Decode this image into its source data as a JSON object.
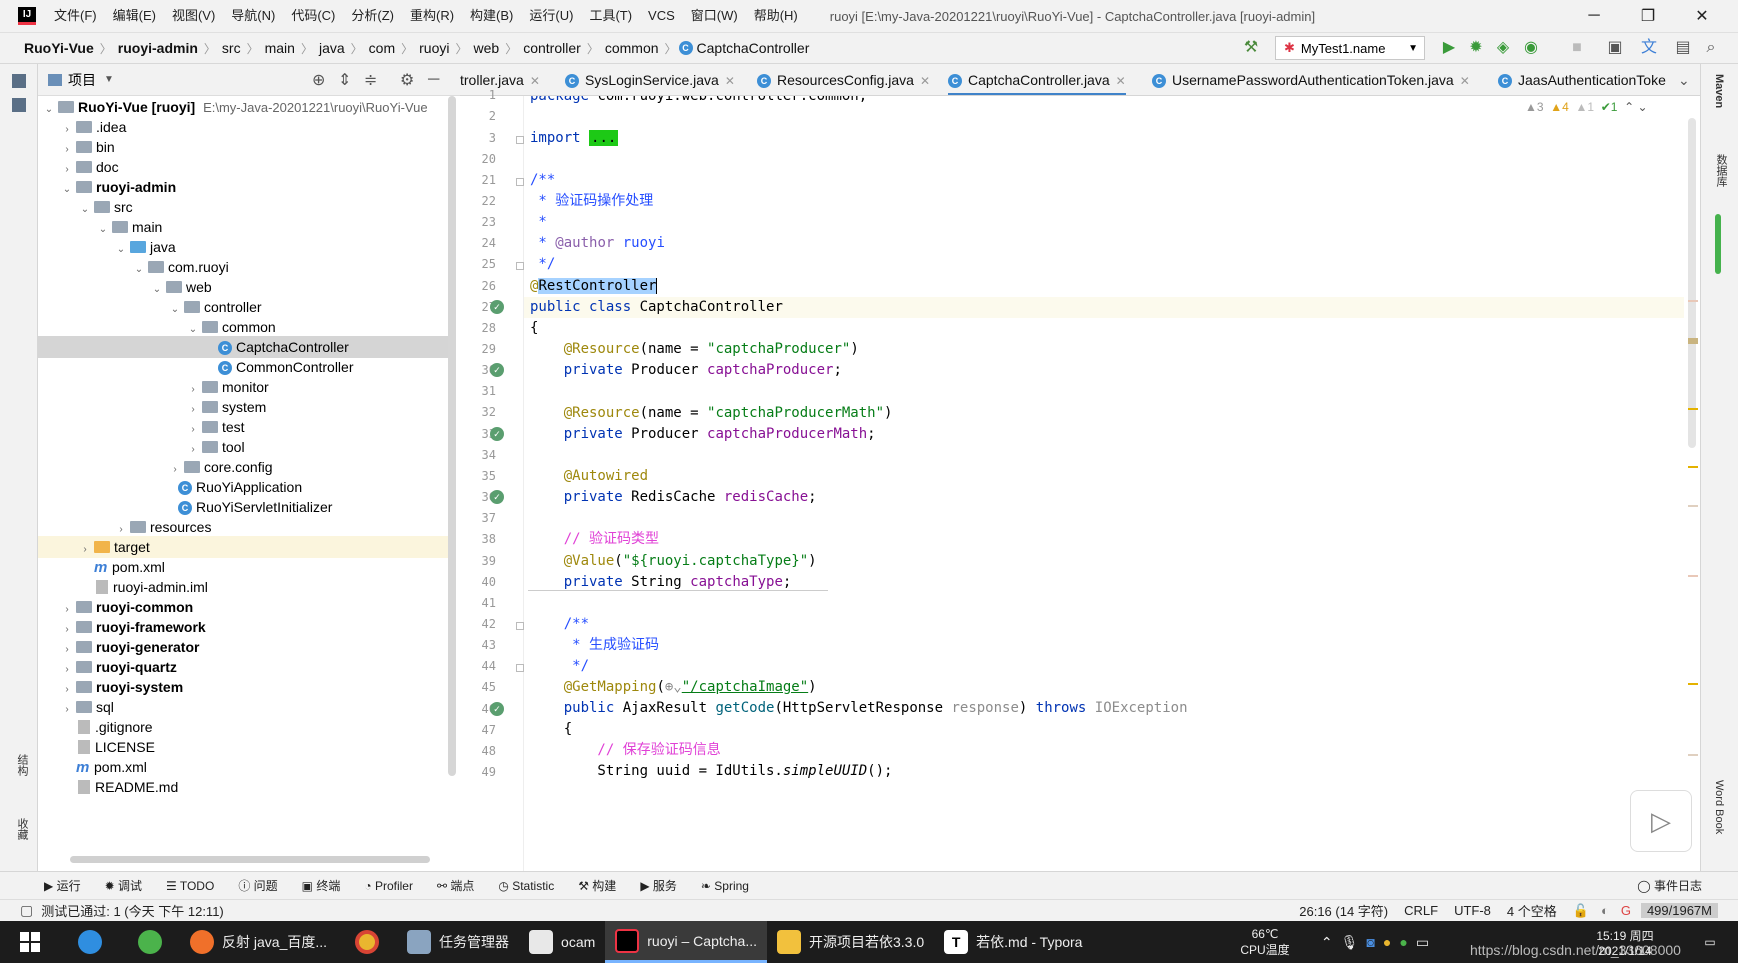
{
  "menubar": {
    "items": [
      "文件(F)",
      "编辑(E)",
      "视图(V)",
      "导航(N)",
      "代码(C)",
      "分析(Z)",
      "重构(R)",
      "构建(B)",
      "运行(U)",
      "工具(T)",
      "VCS",
      "窗口(W)",
      "帮助(H)"
    ],
    "title": "ruoyi [E:\\my-Java-20201221\\ruoyi\\RuoYi-Vue] - CaptchaController.java [ruoyi-admin]"
  },
  "breadcrumb": [
    "RuoYi-Vue",
    "ruoyi-admin",
    "src",
    "main",
    "java",
    "com",
    "ruoyi",
    "web",
    "controller",
    "common",
    "CaptchaController"
  ],
  "run_config": "MyTest1.name",
  "project_panel": {
    "title": "项目",
    "root_name": "RuoYi-Vue [ruoyi]",
    "root_path": "E:\\my-Java-20201221\\ruoyi\\RuoYi-Vue",
    "items": [
      ".idea",
      "bin",
      "doc",
      "ruoyi-admin",
      "src",
      "main",
      "java",
      "com.ruoyi",
      "web",
      "controller",
      "common",
      "CaptchaController",
      "CommonController",
      "monitor",
      "system",
      "test",
      "tool",
      "core.config",
      "RuoYiApplication",
      "RuoYiServletInitializer",
      "resources",
      "target",
      "pom.xml",
      "ruoyi-admin.iml",
      "ruoyi-common",
      "ruoyi-framework",
      "ruoyi-generator",
      "ruoyi-quartz",
      "ruoyi-system",
      "sql",
      ".gitignore",
      "LICENSE",
      "pom.xml",
      "README.md"
    ]
  },
  "tabs": [
    "troller.java",
    "SysLoginService.java",
    "ResourcesConfig.java",
    "CaptchaController.java",
    "UsernamePasswordAuthenticationToken.java",
    "JaasAuthenticationToke"
  ],
  "inspections": {
    "a": "▲3",
    "b": "▲4",
    "c": "▲1",
    "d": "✔1"
  },
  "line_numbers": [
    "1",
    "2",
    "3",
    "20",
    "21",
    "22",
    "23",
    "24",
    "25",
    "26",
    "27",
    "28",
    "29",
    "30",
    "31",
    "32",
    "33",
    "34",
    "35",
    "36",
    "37",
    "38",
    "39",
    "40",
    "41",
    "42",
    "43",
    "44",
    "45",
    "46",
    "47",
    "48",
    "49"
  ],
  "code": {
    "l1": [
      "package ",
      "com.ruoyi.web.controller.common;"
    ],
    "l3": [
      "import ",
      "..."
    ],
    "l21": "/**",
    "l22": " * 验证码操作处理",
    "l23": " *",
    "l24": [
      " * ",
      "@author",
      " ruoyi"
    ],
    "l25": " */",
    "l26": [
      "@",
      "RestController"
    ],
    "l27": [
      "public class ",
      "CaptchaController"
    ],
    "l28": "{",
    "l29": [
      "    @Resource",
      "(name = ",
      "\"captchaProducer\"",
      ")"
    ],
    "l30": [
      "    private ",
      "Producer ",
      "captchaProducer",
      ";"
    ],
    "l32": [
      "    @Resource",
      "(name = ",
      "\"captchaProducerMath\"",
      ")"
    ],
    "l33": [
      "    private ",
      "Producer ",
      "captchaProducerMath",
      ";"
    ],
    "l35": "    @Autowired",
    "l36": [
      "    private ",
      "RedisCache ",
      "redisCache",
      ";"
    ],
    "l38": "    // 验证码类型",
    "l39": [
      "    @Value",
      "(",
      "\"${ruoyi.captchaType}\"",
      ")"
    ],
    "l40": [
      "    private ",
      "String ",
      "captchaType",
      ";"
    ],
    "l42": "    /**",
    "l43": "     * 生成验证码",
    "l44": "     */",
    "l45": [
      "    @GetMapping",
      "(",
      "\"/captchaImage\"",
      ")"
    ],
    "l46": [
      "    public ",
      "AjaxResult ",
      "getCode",
      "(HttpServletResponse ",
      "response",
      ") ",
      "throws ",
      "IOException"
    ],
    "l47": "    {",
    "l48": "        // 保存验证码信息",
    "l49": [
      "        String uuid = IdUtils.",
      "simpleUUID",
      "();"
    ]
  },
  "bottom_tools": [
    "运行",
    "调试",
    "TODO",
    "问题",
    "终端",
    "Profiler",
    "端点",
    "Statistic",
    "构建",
    "服务",
    "Spring",
    "事件日志"
  ],
  "status": {
    "message": "测试已通过: 1 (今天 下午 12:11)",
    "position": "26:16 (14 字符)",
    "line_sep": "CRLF",
    "encoding": "UTF-8",
    "indent": "4 个空格",
    "memory": "499/1967M"
  },
  "right_strip": [
    "Maven",
    "数据库",
    "Word Book"
  ],
  "left_strip": [
    "结构",
    "收藏"
  ],
  "taskbar": {
    "items": [
      "反射 java_百度...",
      "任务管理器",
      "ocam",
      "ruoyi – Captcha...",
      "开源项目若依3.3.0",
      "若依.md - Typora"
    ],
    "temp": "66℃",
    "temp_label": "CPU温度",
    "time": "15:19 周四",
    "date": "2021/1/14",
    "watermark": "https://blog.csdn.net/m_33608000"
  }
}
